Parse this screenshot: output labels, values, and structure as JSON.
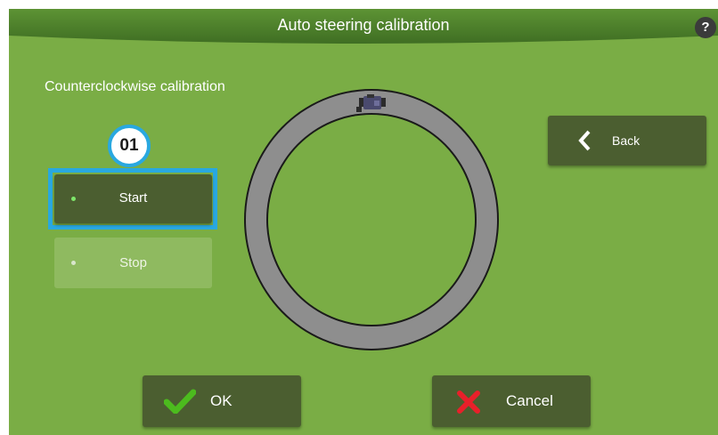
{
  "window": {
    "title": "Auto steering calibration",
    "help_label": "?"
  },
  "calibration": {
    "heading": "Counterclockwise calibration",
    "step_badge": "01",
    "start_label": "Start",
    "stop_label": "Stop"
  },
  "nav": {
    "back_label": "Back"
  },
  "footer": {
    "ok_label": "OK",
    "cancel_label": "Cancel"
  },
  "icons": {
    "back": "chevron-left-icon",
    "ok": "checkmark-icon",
    "cancel": "x-cross-icon",
    "tractor": "tractor-icon",
    "help": "question-icon"
  },
  "colors": {
    "background": "#7aad45",
    "button_dark": "#4b5e30",
    "button_disabled": "#8fba60",
    "highlight": "#29a8e0",
    "track": "#8e8e8e",
    "ok_check": "#4cbb1e",
    "cancel_x": "#e8202a"
  }
}
